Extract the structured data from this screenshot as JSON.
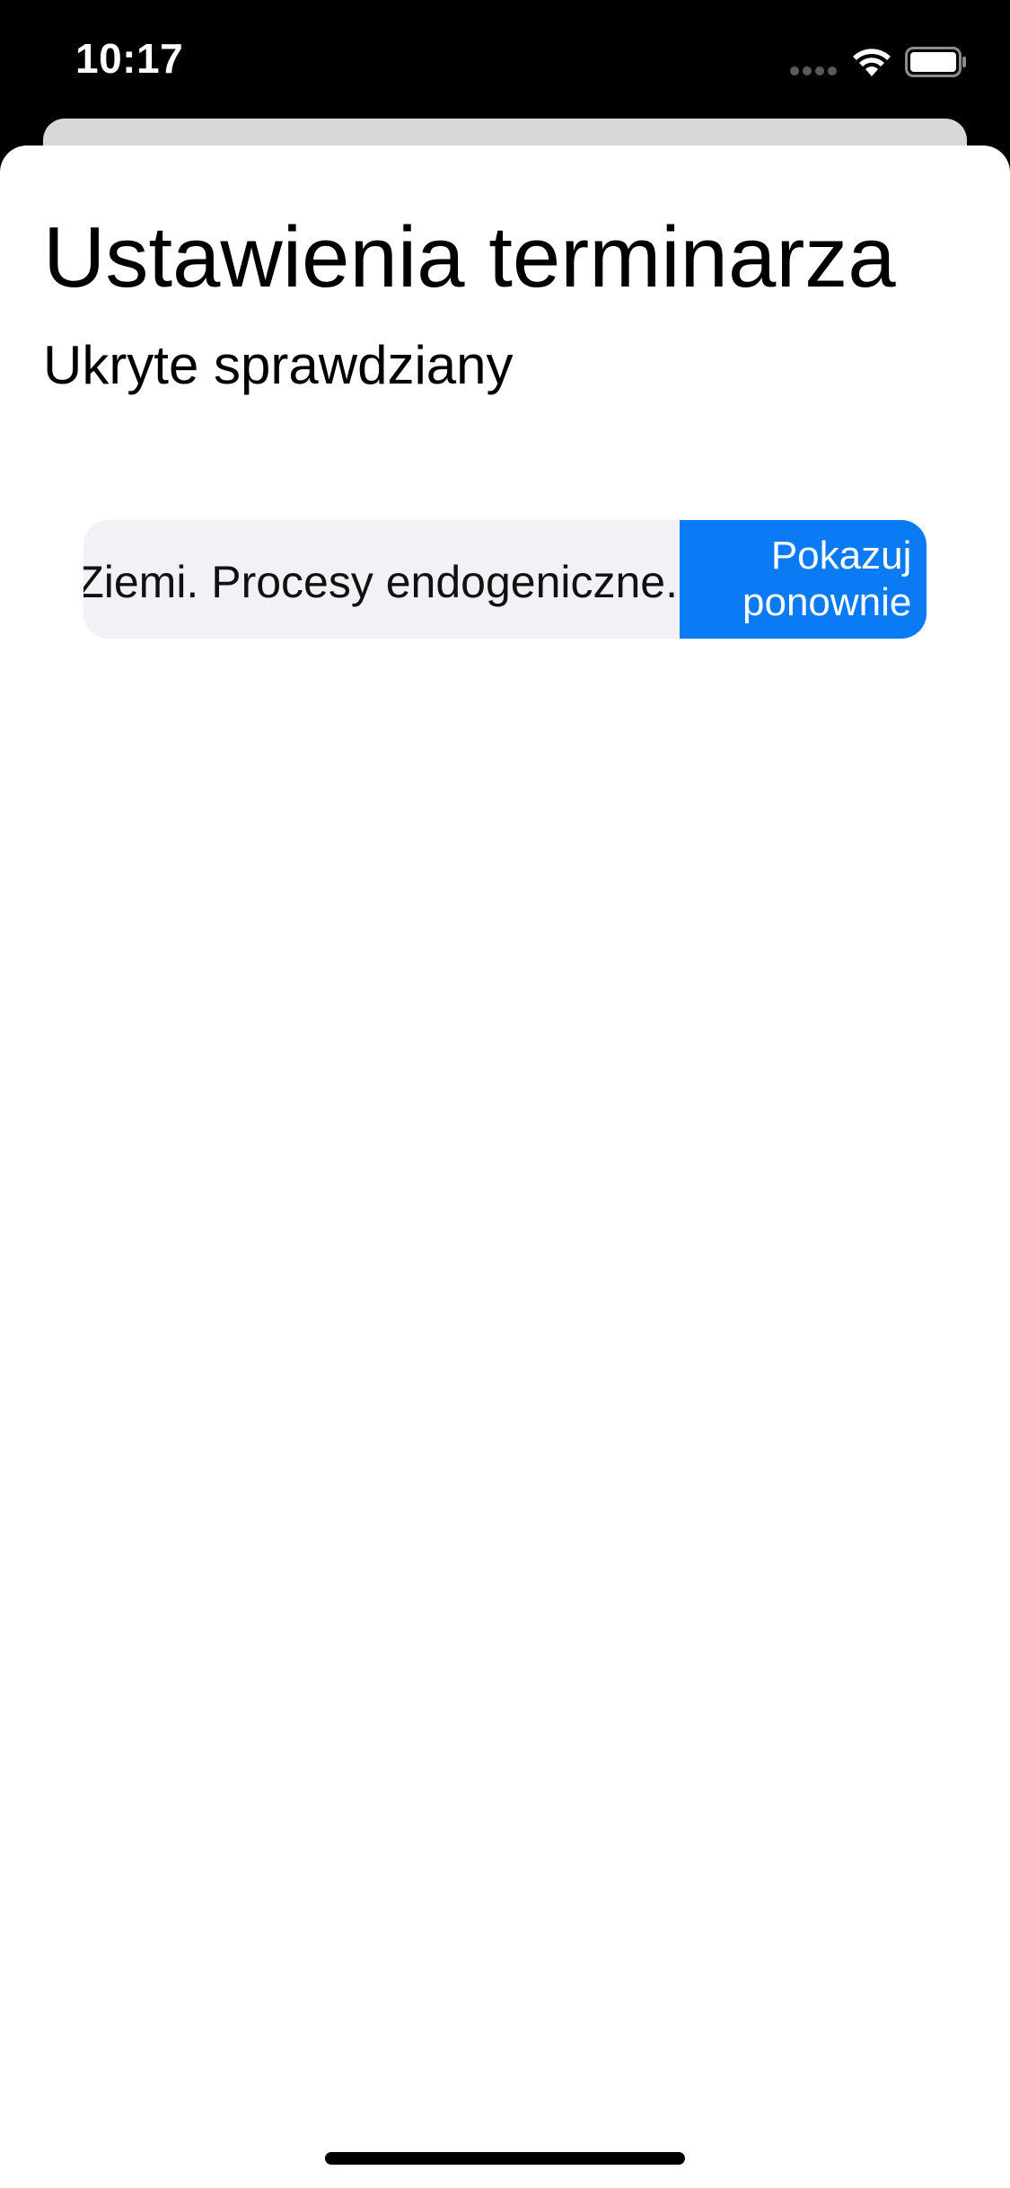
{
  "status_bar": {
    "time": "10:17",
    "icons": [
      "cellular-signal-icon",
      "wifi-icon",
      "battery-icon"
    ]
  },
  "header": {
    "title": "Ustawienia terminarza",
    "section": "Ukryte sprawdziany"
  },
  "hidden_tests": [
    {
      "label": "Ziemi. Procesy endogeniczne.",
      "action": {
        "line1": "Pokazuj",
        "line2": "ponownie"
      }
    }
  ],
  "colors": {
    "accent": "#0a7af5",
    "row_background": "#f2f2f6",
    "sheet_background": "#ffffff",
    "status_bar_background": "#000000"
  }
}
